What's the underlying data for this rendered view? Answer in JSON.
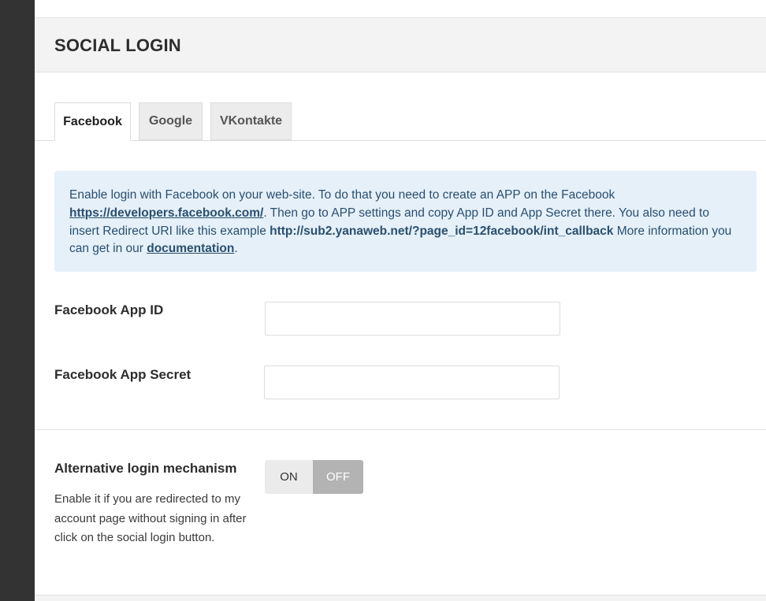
{
  "section": {
    "title": "SOCIAL LOGIN"
  },
  "tabs": [
    {
      "label": "Facebook",
      "active": true
    },
    {
      "label": "Google",
      "active": false
    },
    {
      "label": "VKontakte",
      "active": false
    }
  ],
  "notice": {
    "text_1": "Enable login with Facebook on your web-site. To do that you need to create an APP on the Facebook ",
    "link_developers": "https://developers.facebook.com/",
    "text_2": ". Then go to APP settings and copy App ID and App Secret there. You also need to insert Redirect URI like this example ",
    "redirect_uri": "http://sub2.yanaweb.net/?page_id=12facebook/int_callback",
    "text_3": " More information you can get in our ",
    "link_documentation": "documentation",
    "text_4": "."
  },
  "fields": {
    "app_id": {
      "label": "Facebook App ID",
      "value": "",
      "placeholder": ""
    },
    "app_secret": {
      "label": "Facebook App Secret",
      "value": "",
      "placeholder": ""
    }
  },
  "alternative_login": {
    "label": "Alternative login mechanism",
    "description": "Enable it if you are redirected to my account page without signing in after click on the social login button.",
    "on_label": "ON",
    "off_label": "OFF",
    "state": "OFF"
  },
  "colors": {
    "sidebar": "#333333",
    "notice_bg": "#e5f0f9",
    "notice_text": "#2a4f6e",
    "toggle_off_bg": "#b3b3b3"
  }
}
